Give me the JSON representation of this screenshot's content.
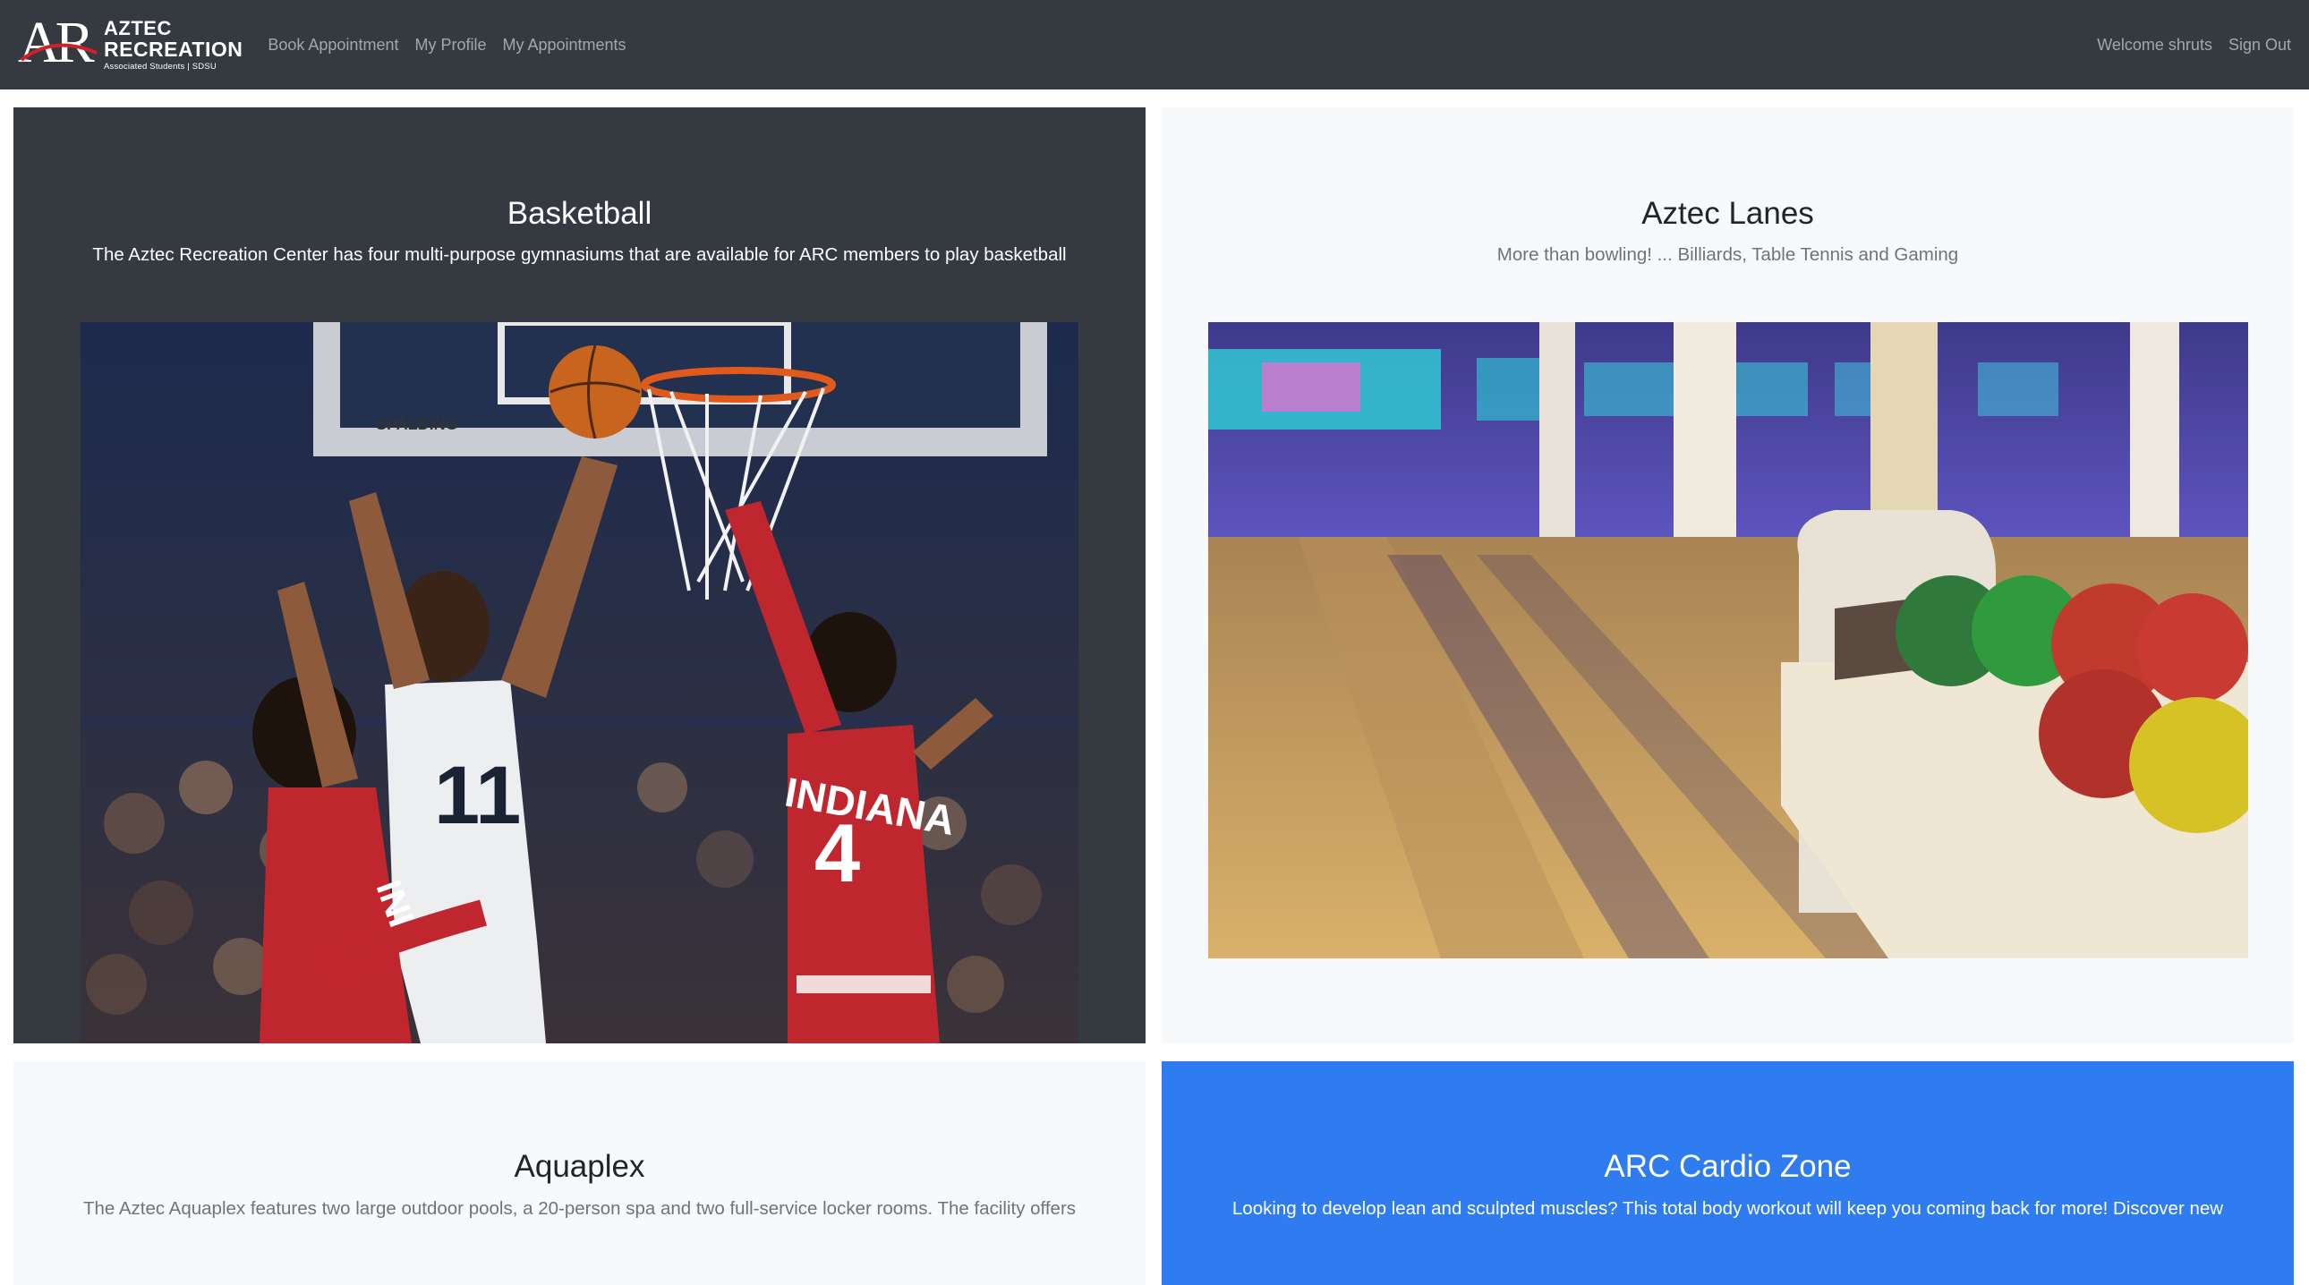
{
  "navbar": {
    "brand": {
      "mark": "AR",
      "line1": "AZTEC",
      "line2": "RECREATION",
      "line3": "Associated Students | SDSU"
    },
    "links": [
      "Book Appointment",
      "My Profile",
      "My Appointments"
    ],
    "welcome": "Welcome shruts",
    "sign_out": "Sign Out"
  },
  "cards": [
    {
      "title": "Basketball",
      "subtitle": "The Aztec Recreation Center has four multi-purpose gymnasiums that are available for ARC members to play basketball",
      "image": "basketball-game-photo",
      "jerseys": [
        "11",
        "INDIANA",
        "4",
        "IND"
      ],
      "backboard_brand": "SPALDING"
    },
    {
      "title": "Aztec Lanes",
      "subtitle": "More than bowling! ... Billiards, Table Tennis and Gaming",
      "image": "bowling-lanes-photo"
    },
    {
      "title": "Aquaplex",
      "subtitle": "The Aztec Aquaplex features two large outdoor pools, a 20-person spa and two full-service locker rooms. The facility offers"
    },
    {
      "title": "ARC Cardio Zone",
      "subtitle": "Looking to develop lean and sculpted muscles? This total body workout will keep you coming back for more! Discover new"
    }
  ],
  "colors": {
    "navbar": "#343a40",
    "card_dark": "#343a40",
    "card_light": "#f8f9fa",
    "card_blue": "#2f7bf0"
  }
}
